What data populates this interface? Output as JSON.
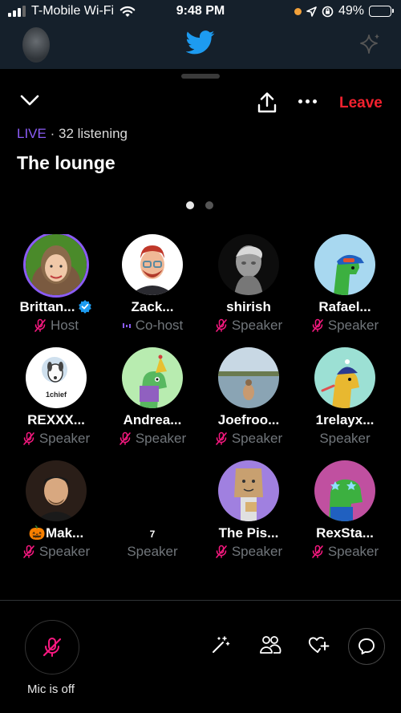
{
  "status_bar": {
    "carrier": "T-Mobile Wi-Fi",
    "time": "9:48 PM",
    "battery": "49%",
    "battery_level": 0.49
  },
  "space": {
    "live_label": "LIVE",
    "separator": "·",
    "listening": "32 listening",
    "title": "The lounge",
    "leave_label": "Leave",
    "page_count": 2,
    "current_page": 1
  },
  "participants": [
    {
      "name": "Brittan...",
      "role": "Host",
      "mic": "off",
      "verified": true,
      "avatar": "avatar-woman-photo"
    },
    {
      "name": "Zack...",
      "role": "Co-host",
      "mic": "speaking",
      "verified": false,
      "avatar": "avatar-cartoon-man"
    },
    {
      "name": "shirish",
      "role": "Speaker",
      "mic": "off",
      "verified": false,
      "avatar": "avatar-statue"
    },
    {
      "name": "Rafael...",
      "role": "Speaker",
      "mic": "off",
      "verified": false,
      "avatar": "avatar-dino-blue-cap"
    },
    {
      "name": "REXXX...",
      "role": "Speaker",
      "mic": "off",
      "verified": false,
      "avatar": "avatar-1chief-dog",
      "avatar_text": "1chief"
    },
    {
      "name": "Andrea...",
      "role": "Speaker",
      "mic": "off",
      "verified": false,
      "avatar": "avatar-dino-party-hat"
    },
    {
      "name": "Joefroo...",
      "role": "Speaker",
      "mic": "off",
      "verified": false,
      "avatar": "avatar-beach-photo"
    },
    {
      "name": "1relayx...",
      "role": "Speaker",
      "mic": "none",
      "verified": false,
      "avatar": "avatar-dino-beanie"
    },
    {
      "name": "🎃Mak...",
      "role": "Speaker",
      "mic": "off",
      "verified": false,
      "avatar": "avatar-man-photo"
    },
    {
      "name": "7",
      "role": "Speaker",
      "mic": "none",
      "verified": false,
      "avatar": "avatar-empty"
    },
    {
      "name": "The Pis...",
      "role": "Speaker",
      "mic": "off",
      "verified": false,
      "avatar": "avatar-paperbag"
    },
    {
      "name": "RexSta...",
      "role": "Speaker",
      "mic": "off",
      "verified": false,
      "avatar": "avatar-dino-stars"
    }
  ],
  "bottom_bar": {
    "mic_label": "Mic is off"
  },
  "icons": {
    "status": [
      "signal-icon",
      "wifi-icon",
      "location-icon",
      "rotation-lock-icon",
      "battery-icon"
    ],
    "header": [
      "twitter-bird-icon",
      "sparkle-icon"
    ],
    "sheet": [
      "chevron-down-icon",
      "share-icon",
      "more-icon"
    ],
    "bottom": [
      "mic-off-icon",
      "sparkles-icon",
      "people-icon",
      "heart-plus-icon",
      "chat-icon"
    ]
  },
  "colors": {
    "accent": "#8b5cf6",
    "leave": "#f4212e",
    "mic_off": "#f91880",
    "muted_text": "#71767b",
    "twitter_blue": "#1d9bf0"
  }
}
